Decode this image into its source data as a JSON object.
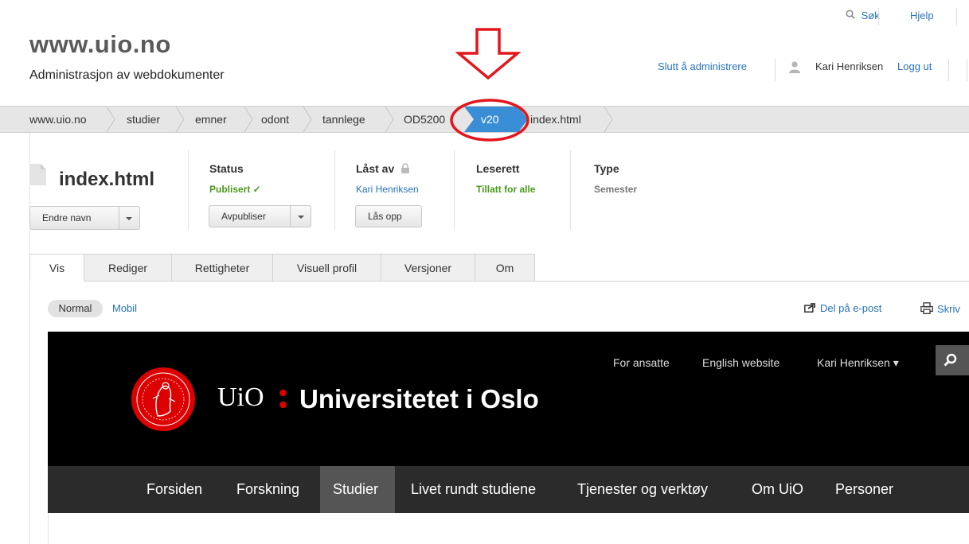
{
  "header": {
    "site_title": "www.uio.no",
    "site_subtitle": "Administrasjon av webdokumenter",
    "search_label": "Søk",
    "help_label": "Hjelp",
    "stop_admin_label": "Slutt å administrere",
    "user_name": "Kari Henriksen",
    "logout_label": "Logg ut"
  },
  "breadcrumb": {
    "items": [
      {
        "label": "www.uio.no"
      },
      {
        "label": "studier"
      },
      {
        "label": "emner"
      },
      {
        "label": "odont"
      },
      {
        "label": "tannlege"
      },
      {
        "label": "OD5200"
      },
      {
        "label": "v20",
        "active": true
      },
      {
        "label": "index.html"
      }
    ]
  },
  "document": {
    "file_name": "index.html",
    "rename_button": "Endre navn",
    "status": {
      "heading": "Status",
      "value": "Publisert ✓",
      "button": "Avpubliser"
    },
    "locked_by": {
      "heading": "Låst av",
      "value": "Kari Henriksen",
      "button": "Lås opp"
    },
    "read_access": {
      "heading": "Leserett",
      "value": "Tillatt for alle"
    },
    "type": {
      "heading": "Type",
      "value": "Semester"
    }
  },
  "tabs": [
    {
      "label": "Vis",
      "active": true
    },
    {
      "label": "Rediger"
    },
    {
      "label": "Rettigheter"
    },
    {
      "label": "Visuell profil"
    },
    {
      "label": "Versjoner"
    },
    {
      "label": "Om"
    }
  ],
  "view_toolbar": {
    "normal_label": "Normal",
    "mobile_label": "Mobil",
    "share_label": "Del på e-post",
    "print_label": "Skriv"
  },
  "preview": {
    "top_links": [
      "For ansatte",
      "English website",
      "Kari Henriksen ▾"
    ],
    "logo_uio": "UiO",
    "logo_name": "Universitetet i Oslo",
    "nav": [
      "Forsiden",
      "Forskning",
      "Studier",
      "Livet rundt studiene",
      "Tjenester og verktøy",
      "Om UiO",
      "Personer"
    ],
    "active_nav": "Studier"
  },
  "colors": {
    "link": "#2771bb",
    "status_green": "#4a9a1a",
    "breadcrumb_active": "#3a8ed6",
    "annotation_red": "#e3161c",
    "uio_red": "#dd0000"
  },
  "icons": {
    "search": "search-icon",
    "user": "user-icon",
    "lock": "lock-icon",
    "file": "file-icon",
    "share": "share-icon",
    "print": "print-icon"
  }
}
